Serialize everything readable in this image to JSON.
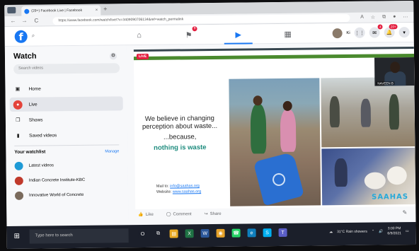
{
  "browser": {
    "tab_title": "(29+) Facebook Live | Facebook",
    "new_tab": "+",
    "url": "https://www.facebook.com/watch/live/?v=3409090706134&ref=watch_permalink",
    "back": "←",
    "forward": "→",
    "reload": "C"
  },
  "header": {
    "logo": "f",
    "search_icon": "⌕",
    "nav": [
      {
        "name": "home",
        "glyph": "⌂",
        "badge": ""
      },
      {
        "name": "pages",
        "glyph": "⚑",
        "badge": "9"
      },
      {
        "name": "watch",
        "glyph": "▶",
        "badge": ""
      },
      {
        "name": "marketplace",
        "glyph": "▦",
        "badge": ""
      },
      {
        "name": "groups",
        "glyph": "☺",
        "badge": ""
      }
    ],
    "profile_name": "Ki",
    "menu_glyph": "⋮⋮",
    "messenger_badge": "4",
    "notifications_badge": "20+"
  },
  "sidebar": {
    "title": "Watch",
    "search_placeholder": "Search videos",
    "items": [
      {
        "label": "Home",
        "glyph": "▣"
      },
      {
        "label": "Live",
        "glyph": "●"
      },
      {
        "label": "Shows",
        "glyph": "❐"
      },
      {
        "label": "Saved videos",
        "glyph": "▮"
      }
    ],
    "watchlist_title": "Your watchlist",
    "manage": "Manage",
    "watchlist": [
      {
        "label": "Latest videos",
        "color": "#1e9ad6"
      },
      {
        "label": "Indian Concrete Institute-KBC",
        "color": "#c0392b"
      },
      {
        "label": "Innovative World of Concrete",
        "color": "#7a6a5c"
      }
    ]
  },
  "video": {
    "live_badge": "LIVE",
    "slide_line1": "We believe in changing perception about waste...",
    "slide_line2": "...because,",
    "slide_line3": "nothing is waste",
    "mail_label": "Mail to:",
    "mail_value": "info@saahas.org",
    "website_label": "Website:",
    "website_value": "www.saahas.org",
    "cam_name": "NAVEEN B",
    "brand": "SAAHAS",
    "actions": [
      {
        "label": "Like",
        "glyph": "👍"
      },
      {
        "label": "Comment",
        "glyph": "◯"
      },
      {
        "label": "Share",
        "glyph": "↪"
      }
    ],
    "edit_glyph": "✎"
  },
  "taskbar": {
    "start": "⊞",
    "search_placeholder": "Type here to search",
    "apps": [
      {
        "name": "cortana",
        "glyph": "O",
        "color": "#1b1f2a"
      },
      {
        "name": "task-view",
        "glyph": "⧉",
        "color": "#1b1f2a"
      },
      {
        "name": "file-explorer",
        "glyph": "▤",
        "color": "#e8a923"
      },
      {
        "name": "excel",
        "glyph": "X",
        "color": "#1f7244"
      },
      {
        "name": "word",
        "glyph": "W",
        "color": "#2b579a"
      },
      {
        "name": "chrome",
        "glyph": "◉",
        "color": "#e6a22a"
      },
      {
        "name": "whatsapp",
        "glyph": "☎",
        "color": "#25d366"
      },
      {
        "name": "edge",
        "glyph": "e",
        "color": "#0f7fbd"
      },
      {
        "name": "skype",
        "glyph": "S",
        "color": "#00aff0"
      },
      {
        "name": "teams",
        "glyph": "T",
        "color": "#5b5fc7"
      }
    ],
    "weather": "31°C  Rain showers",
    "time": "3:00 PM",
    "date": "6/9/2021"
  }
}
